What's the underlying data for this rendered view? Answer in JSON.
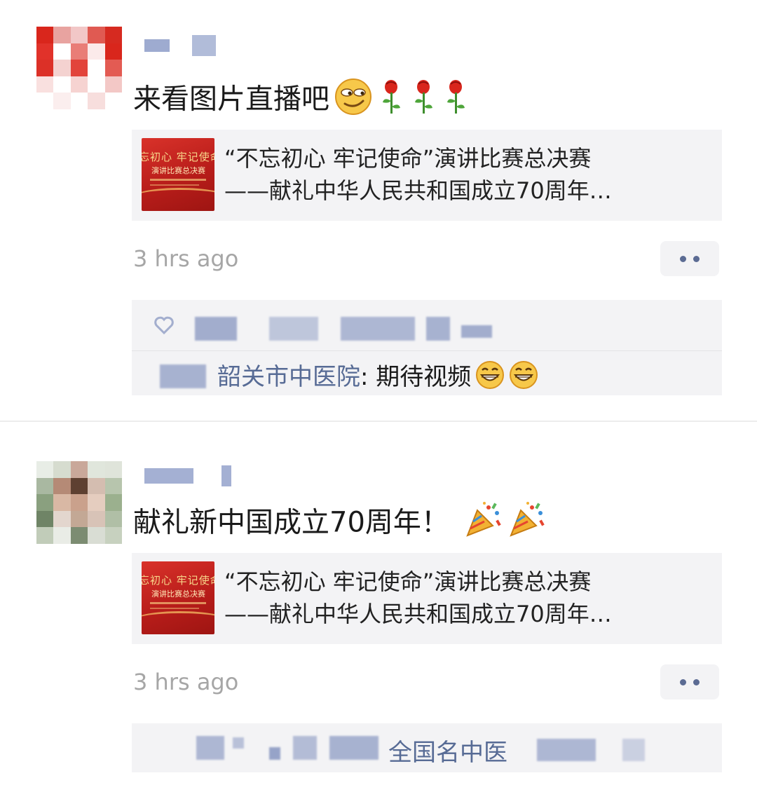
{
  "posts": [
    {
      "content": "来看图片直播吧",
      "emoji": [
        "smirk-emoji",
        "rose-emoji",
        "rose-emoji",
        "rose-emoji"
      ],
      "link": {
        "thumb_line1": "忘初心 牢记使命",
        "thumb_line2": "演讲比赛总决赛",
        "title_line1": "“不忘初心 牢记使命”演讲比赛总决赛",
        "title_line2": "——献礼中华人民共和国成立70周年…"
      },
      "time": "3 hrs ago",
      "comment": {
        "name": "韶关市中医院",
        "separator": ": ",
        "text": "期待视频",
        "emoji": [
          "grin-emoji",
          "grin-emoji"
        ]
      }
    },
    {
      "content": "献礼新中国成立70周年！",
      "emoji": [
        "party-popper-emoji",
        "party-popper-emoji"
      ],
      "link": {
        "thumb_line1": "忘初心 牢记使命",
        "thumb_line2": "演讲比赛总决赛",
        "title_line1": "“不忘初心 牢记使命”演讲比赛总决赛",
        "title_line2": "——献礼中华人民共和国成立70周年…"
      },
      "time": "3 hrs ago",
      "like_names_visible": "全国名中医"
    }
  ],
  "colors": {
    "link_blue": "#576b95",
    "card_bg": "#f3f3f5",
    "time_gray": "#a6a6a6",
    "thumb_red": "#c8231f"
  }
}
